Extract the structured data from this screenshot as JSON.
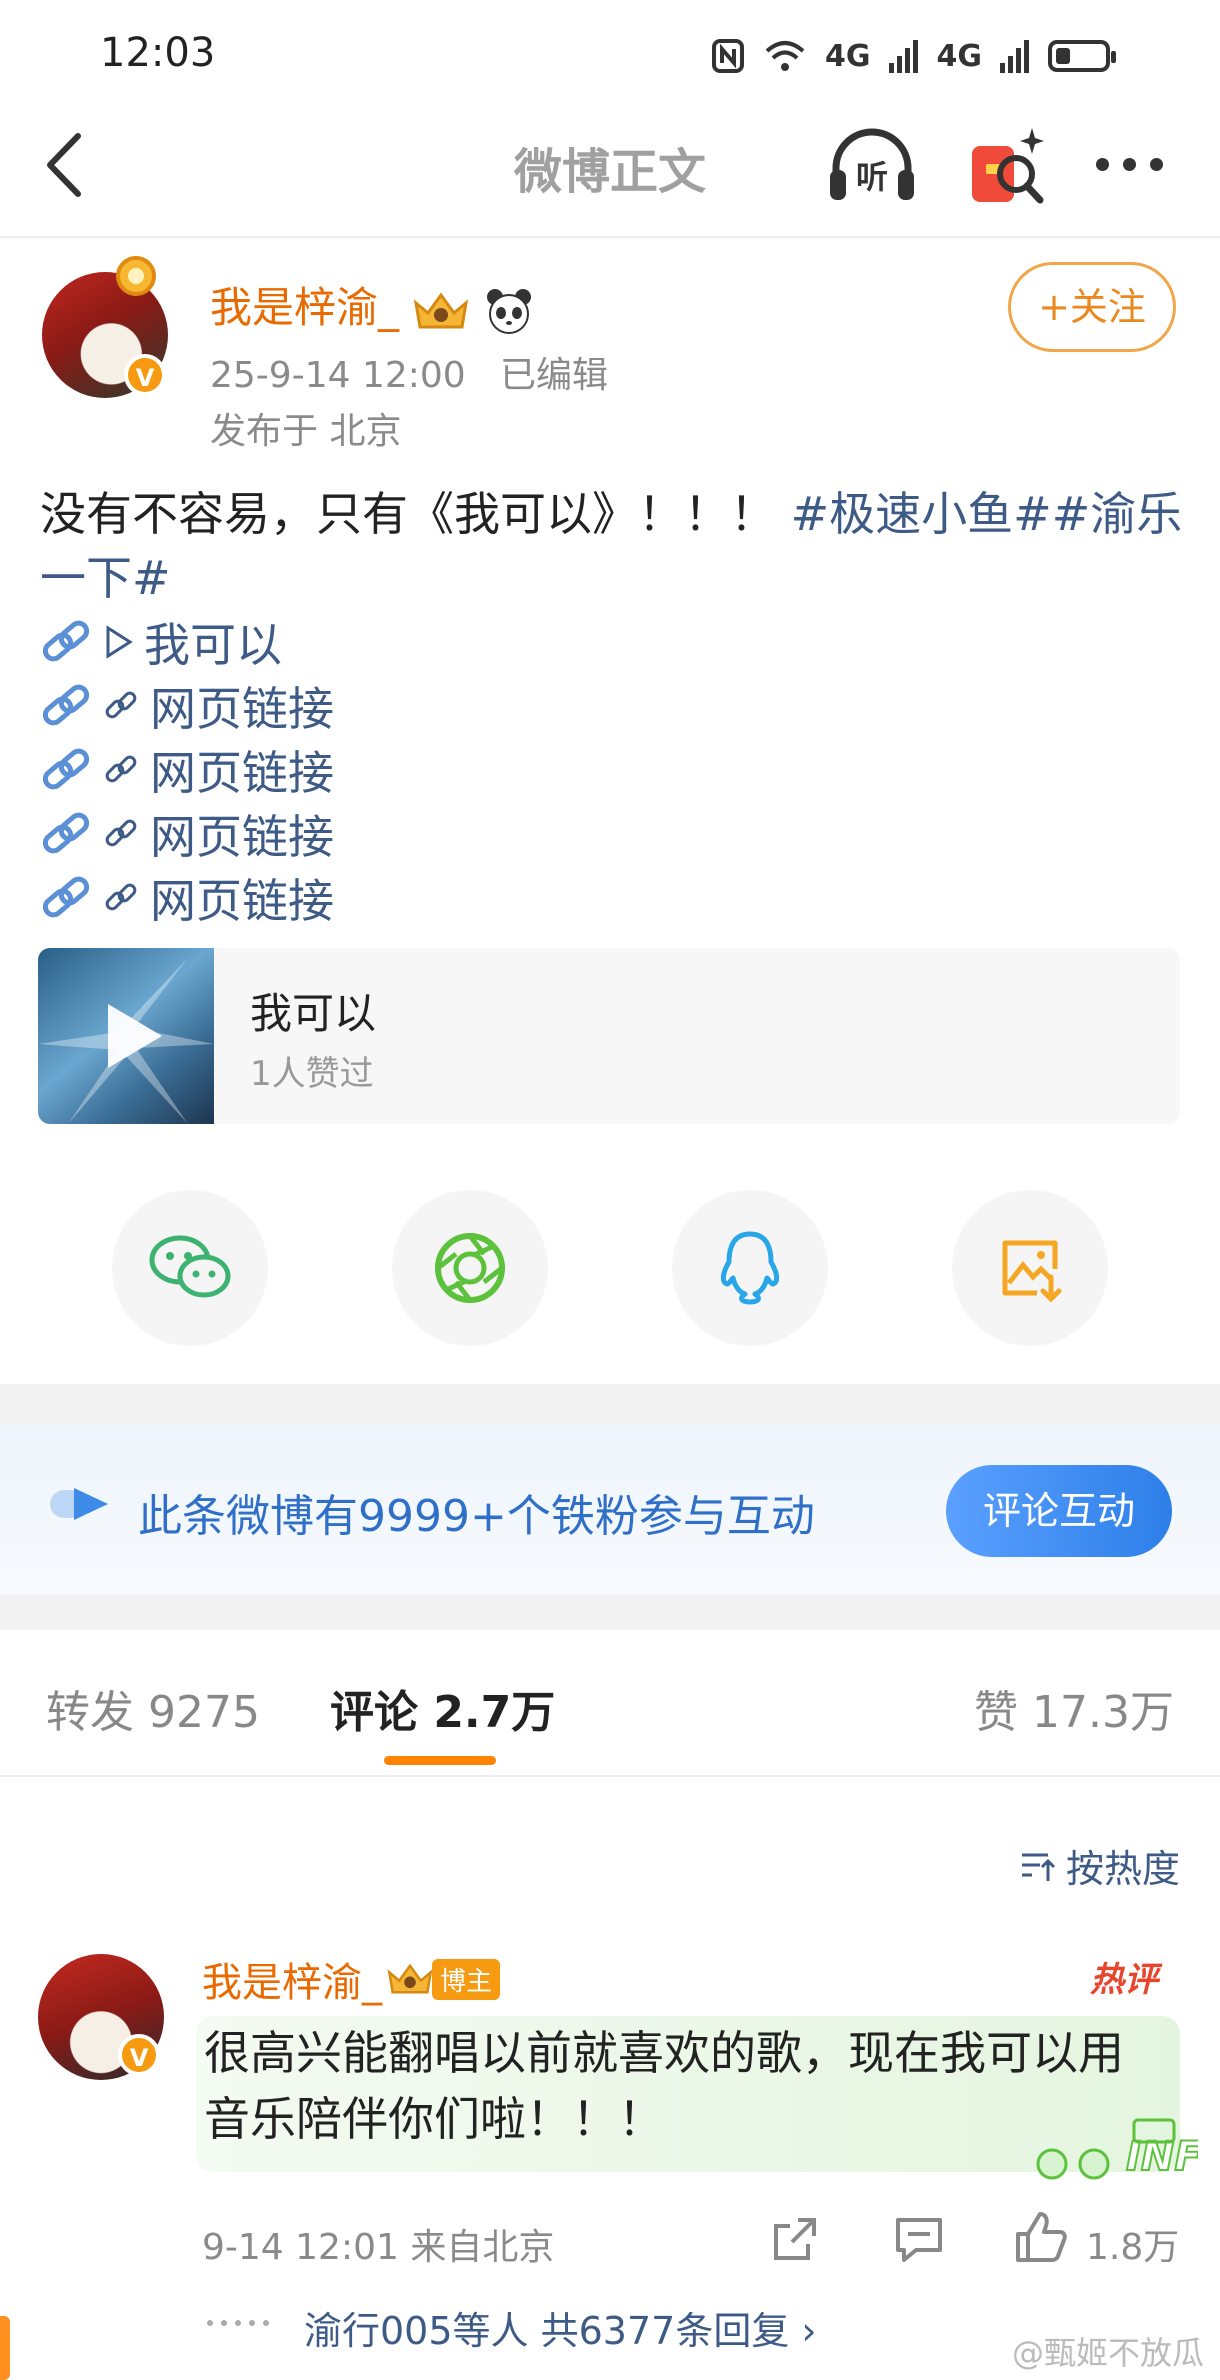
{
  "status_bar": {
    "time": "12:03",
    "signal_1": "4G",
    "signal_2": "4G"
  },
  "nav": {
    "title": "微博正文",
    "listen_label": "听"
  },
  "post": {
    "author_name": "我是梓渝_",
    "timestamp": "25-9-14 12:00",
    "edited": "已编辑",
    "location": "发布于 北京",
    "follow_label": "+关注",
    "text": "没有不容易，只有《我可以》！！！",
    "topic_1": "#极速小鱼#",
    "topic_2": "#渝乐一下#",
    "links": [
      {
        "label": "我可以",
        "kind": "play"
      },
      {
        "label": "网页链接",
        "kind": "web"
      },
      {
        "label": "网页链接",
        "kind": "web"
      },
      {
        "label": "网页链接",
        "kind": "web"
      },
      {
        "label": "网页链接",
        "kind": "web"
      }
    ],
    "music": {
      "title": "我可以",
      "likes": "1人赞过"
    }
  },
  "share": [
    "wechat-icon",
    "moments-icon",
    "qq-icon",
    "save-image-icon"
  ],
  "fans_banner": {
    "text": "此条微博有9999+个铁粉参与互动",
    "button": "评论互动"
  },
  "tabs": {
    "repost": "转发 9275",
    "comments": "评论 2.7万",
    "likes": "赞 17.3万"
  },
  "sort_label": "按热度",
  "comment": {
    "author": "我是梓渝_",
    "role_badge": "博主",
    "hot_badge": "热评",
    "text": "很高兴能翻唱以前就喜欢的歌，现在我可以用音乐陪伴你们啦！！！",
    "time_location": "9-14 12:01  来自北京",
    "like_count": "1.8万",
    "replies_summary": "渝行005等人  共6377条回复 ›"
  },
  "watermark": "@甄姬不放瓜",
  "colors": {
    "accent": "#ff8200",
    "link": "#3d5b86",
    "name": "#e86a00",
    "banner_blue": "#2f6fc8"
  }
}
